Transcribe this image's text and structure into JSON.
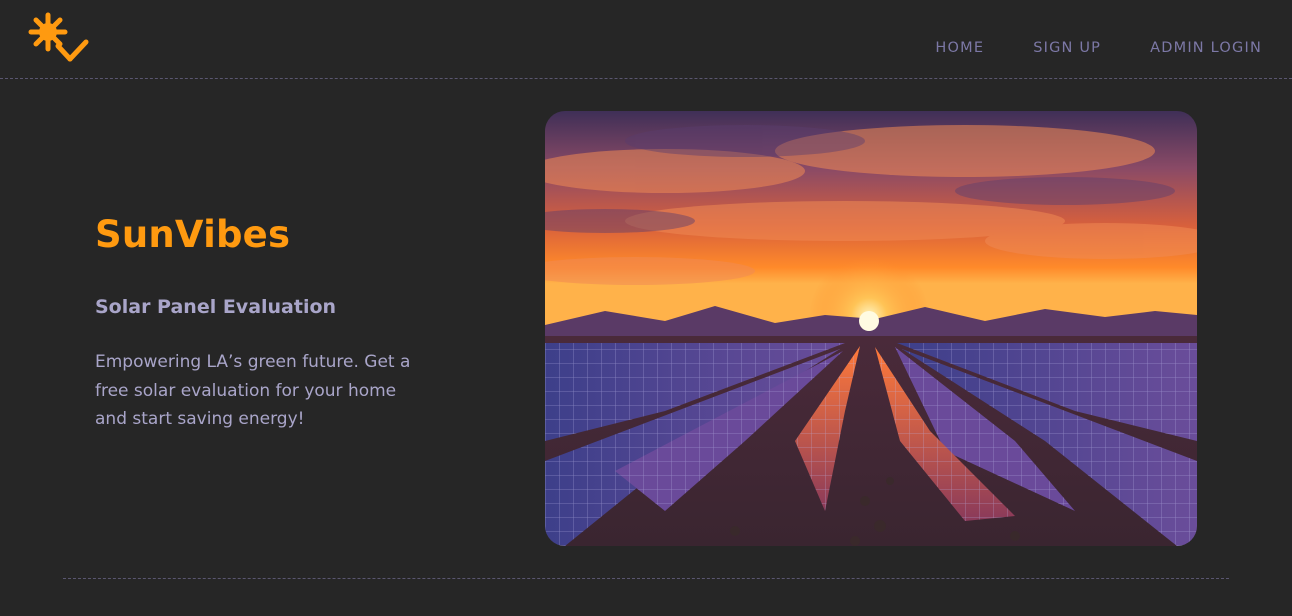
{
  "brand": {
    "logo_icon": "sun-logo-icon",
    "accent_color": "#ff9a10"
  },
  "nav": {
    "items": [
      {
        "label": "HOME"
      },
      {
        "label": "SIGN UP"
      },
      {
        "label": "ADMIN LOGIN"
      }
    ]
  },
  "hero": {
    "title": "SunVibes",
    "subtitle": "Solar Panel Evaluation",
    "description": "Empowering LA’s green future. Get a free solar evaluation for your home and start saving energy!",
    "image_icon": "solar-farm-sunset-image"
  },
  "colors": {
    "background": "#262626",
    "nav_text": "#7c78a6",
    "body_text": "#a9a5c9",
    "divider": "#5a5670"
  }
}
